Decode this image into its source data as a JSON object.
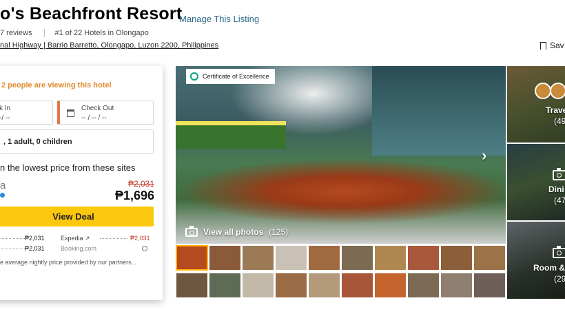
{
  "header": {
    "title": "o's Beachfront Resort",
    "manage_link": "Manage This Listing",
    "reviews": "7 reviews",
    "ranking": "#1 of 22 Hotels in Olongapo",
    "address": "nal Highway | Barrio Barretto, Olongapo, Luzon 2200, Philippines",
    "save_label": "Sav"
  },
  "booking": {
    "viewing_notice": "2 people are viewing this hotel",
    "check_in_label": "k In",
    "check_in_value": "-/ --",
    "check_out_label": "Check Out",
    "check_out_value": "-- / -- / --",
    "guests": ", 1 adult, 0 children",
    "lowest_price_text": "n the lowest price from these sites",
    "provider": "a",
    "old_price": "₱2,031",
    "price": "₱1,696",
    "deal_button": "View Deal",
    "other_sites": [
      {
        "price": "₱2,031",
        "site": "Expedia ↗",
        "site_price": "₱2,031"
      },
      {
        "price": "₱2,031",
        "site": "Booking.com"
      }
    ],
    "footnote": "e average nightly price provided by our partners..."
  },
  "gallery": {
    "badge": "Certificate of Excellence",
    "view_all_label": "View all photos",
    "view_all_count": "(125)",
    "side": [
      {
        "label": "Trave",
        "count": "(49"
      },
      {
        "label": "Dini",
        "count": "(47"
      },
      {
        "label": "Room &",
        "count": "(29"
      }
    ]
  },
  "colors": {
    "accent_yellow": "#fcc80d",
    "link_blue": "#2d6a8f",
    "viewing_orange": "#e0892b",
    "strike_red": "#c0392b"
  }
}
